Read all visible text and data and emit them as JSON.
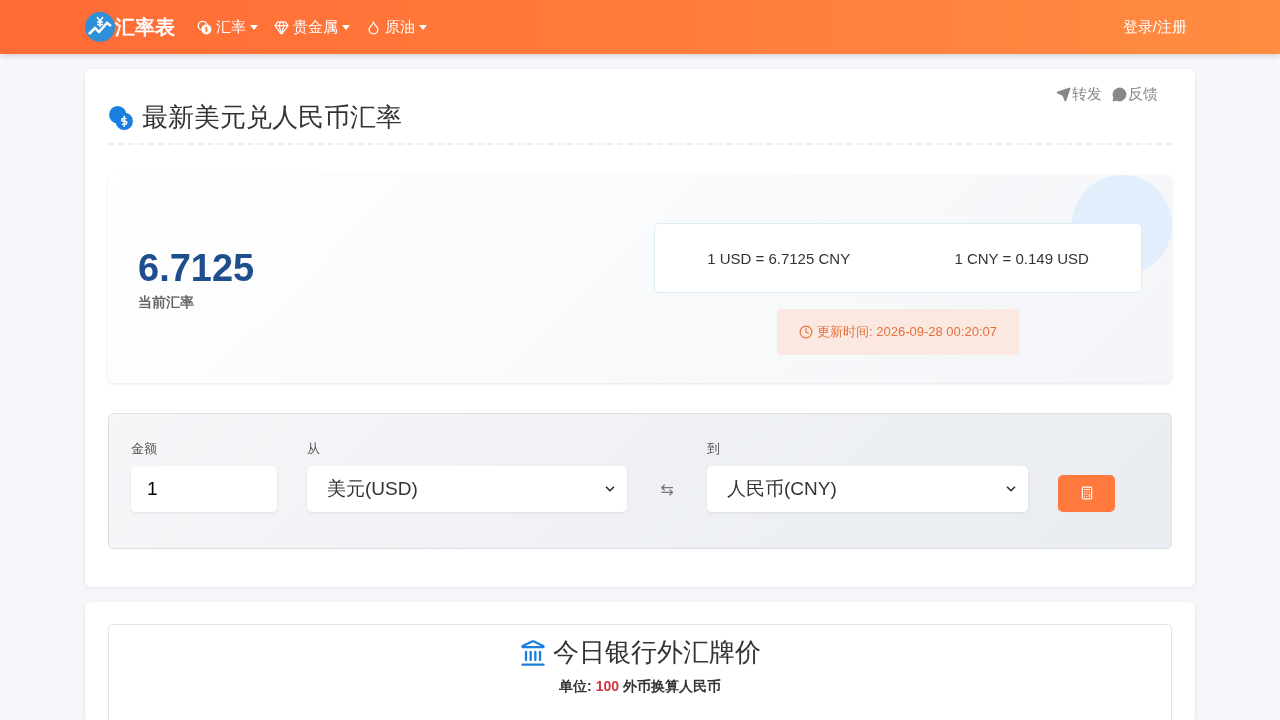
{
  "navbar": {
    "brand": "汇率表",
    "menu": [
      {
        "kind": "coins",
        "label": "汇率"
      },
      {
        "kind": "gem",
        "label": "贵金属"
      },
      {
        "kind": "drop",
        "label": "原油"
      }
    ],
    "login": "登录/注册"
  },
  "card": {
    "actions": [
      {
        "kind": "share",
        "label": "转发"
      },
      {
        "kind": "comment",
        "label": "反馈"
      }
    ],
    "title": "最新美元兑人民币汇率",
    "rate": "6.7125",
    "rate_label": "当前汇率",
    "pairs": [
      "1 USD = 6.7125 CNY",
      "1 CNY = 0.149 USD"
    ],
    "updated": "更新时间: 2026-09-28 00:20:07"
  },
  "converter": {
    "amount_label": "金额",
    "amount": "1",
    "from_label": "从",
    "from": "美元(USD)",
    "swap": "⇆",
    "to_label": "到",
    "to": "人民币(CNY)"
  },
  "bank": {
    "title": "今日银行外汇牌价",
    "unit_prefix": "单位: ",
    "unit_value": "100",
    "unit_suffix": " 外币换算人民币"
  }
}
